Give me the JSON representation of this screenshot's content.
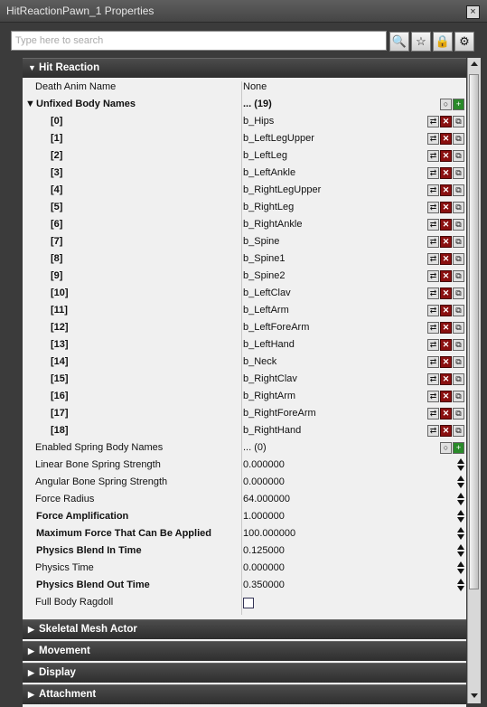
{
  "window": {
    "title": "HitReactionPawn_1 Properties",
    "close_glyph": "×"
  },
  "search": {
    "placeholder": "Type here to search"
  },
  "toolbar": {
    "icons": [
      "search-icon",
      "star-icon",
      "lock-icon",
      "settings-icon"
    ]
  },
  "categories": {
    "hit_reaction": "Hit Reaction",
    "skeletal_mesh_actor": "Skeletal Mesh Actor",
    "movement": "Movement",
    "display": "Display",
    "attachment": "Attachment"
  },
  "properties": {
    "death_anim_name": {
      "label": "Death Anim Name",
      "value": "None"
    },
    "unfixed_body_names": {
      "label": "Unfixed Body Names",
      "value": "... (19)",
      "items": [
        {
          "index": "[0]",
          "value": "b_Hips"
        },
        {
          "index": "[1]",
          "value": "b_LeftLegUpper"
        },
        {
          "index": "[2]",
          "value": "b_LeftLeg"
        },
        {
          "index": "[3]",
          "value": "b_LeftAnkle"
        },
        {
          "index": "[4]",
          "value": "b_RightLegUpper"
        },
        {
          "index": "[5]",
          "value": "b_RightLeg"
        },
        {
          "index": "[6]",
          "value": "b_RightAnkle"
        },
        {
          "index": "[7]",
          "value": "b_Spine"
        },
        {
          "index": "[8]",
          "value": "b_Spine1"
        },
        {
          "index": "[9]",
          "value": "b_Spine2"
        },
        {
          "index": "[10]",
          "value": "b_LeftClav"
        },
        {
          "index": "[11]",
          "value": "b_LeftArm"
        },
        {
          "index": "[12]",
          "value": "b_LeftForeArm"
        },
        {
          "index": "[13]",
          "value": "b_LeftHand"
        },
        {
          "index": "[14]",
          "value": "b_Neck"
        },
        {
          "index": "[15]",
          "value": "b_RightClav"
        },
        {
          "index": "[16]",
          "value": "b_RightArm"
        },
        {
          "index": "[17]",
          "value": "b_RightForeArm"
        },
        {
          "index": "[18]",
          "value": "b_RightHand"
        }
      ]
    },
    "enabled_spring_body_names": {
      "label": "Enabled Spring Body Names",
      "value": "... (0)"
    },
    "linear_bone_spring_strength": {
      "label": "Linear Bone Spring Strength",
      "value": "0.000000"
    },
    "angular_bone_spring_strength": {
      "label": "Angular Bone Spring Strength",
      "value": "0.000000"
    },
    "force_radius": {
      "label": "Force Radius",
      "value": "64.000000"
    },
    "force_amplification": {
      "label": "Force Amplification",
      "value": "1.000000"
    },
    "max_force": {
      "label": "Maximum Force That Can Be Applied",
      "value": "100.000000"
    },
    "physics_blend_in_time": {
      "label": "Physics Blend In Time",
      "value": "0.125000"
    },
    "physics_time": {
      "label": "Physics Time",
      "value": "0.000000"
    },
    "physics_blend_out_time": {
      "label": "Physics Blend Out Time",
      "value": "0.350000"
    },
    "full_body_ragdoll": {
      "label": "Full Body Ragdoll",
      "checked": false
    }
  }
}
